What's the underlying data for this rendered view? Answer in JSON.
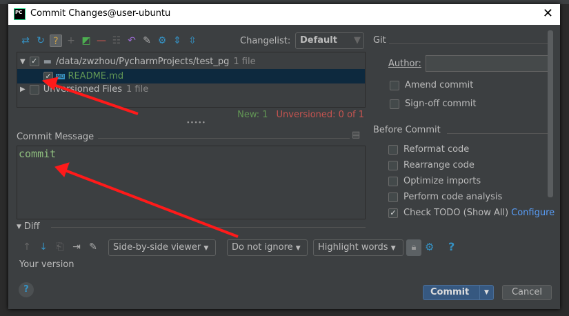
{
  "window": {
    "title": "Commit Changes@user-ubuntu",
    "logo": "PC"
  },
  "toolbar": {
    "icons": [
      "diff-icon",
      "refresh-icon",
      "group-by-icon",
      "add-icon",
      "move-icon",
      "remove-icon",
      "select-icon",
      "revert-icon",
      "edit-icon",
      "settings-icon",
      "expand-all-icon",
      "collapse-all-icon"
    ],
    "changelist_label": "Changelist:",
    "changelist_value": "Default"
  },
  "tree": {
    "root_path": "/data/zwzhou/PycharmProjects/test_pg",
    "root_count": "1 file",
    "file": "README.md",
    "file_icon": "MD",
    "unversioned": "Unversioned Files",
    "unversioned_count": "1 file"
  },
  "status": {
    "new": "New: 1",
    "unversioned": "Unversioned: 0 of 1"
  },
  "commit_message": {
    "label": "Commit Message",
    "value": "commit"
  },
  "git": {
    "header": "Git",
    "author_label": "Author:",
    "author_value": "",
    "amend": "Amend commit",
    "signoff": "Sign-off commit"
  },
  "before_commit": {
    "header": "Before Commit",
    "items": [
      {
        "label": "Reformat code",
        "checked": false
      },
      {
        "label": "Rearrange code",
        "checked": false
      },
      {
        "label": "Optimize imports",
        "checked": false
      },
      {
        "label": "Perform code analysis",
        "checked": false
      },
      {
        "label": "Check TODO (Show All)",
        "checked": true
      }
    ],
    "configure": "Configure"
  },
  "diff": {
    "label": "Diff",
    "viewer": "Side-by-side viewer",
    "ignore": "Do not ignore",
    "highlight": "Highlight words",
    "help": "?",
    "your_version": "Your version"
  },
  "buttons": {
    "help": "?",
    "commit": "Commit",
    "cancel": "Cancel"
  },
  "colors": {
    "accent": "#365880",
    "new": "#629755",
    "unversioned": "#c75450",
    "link": "#589df6",
    "annotation": "#ff1a1a"
  }
}
